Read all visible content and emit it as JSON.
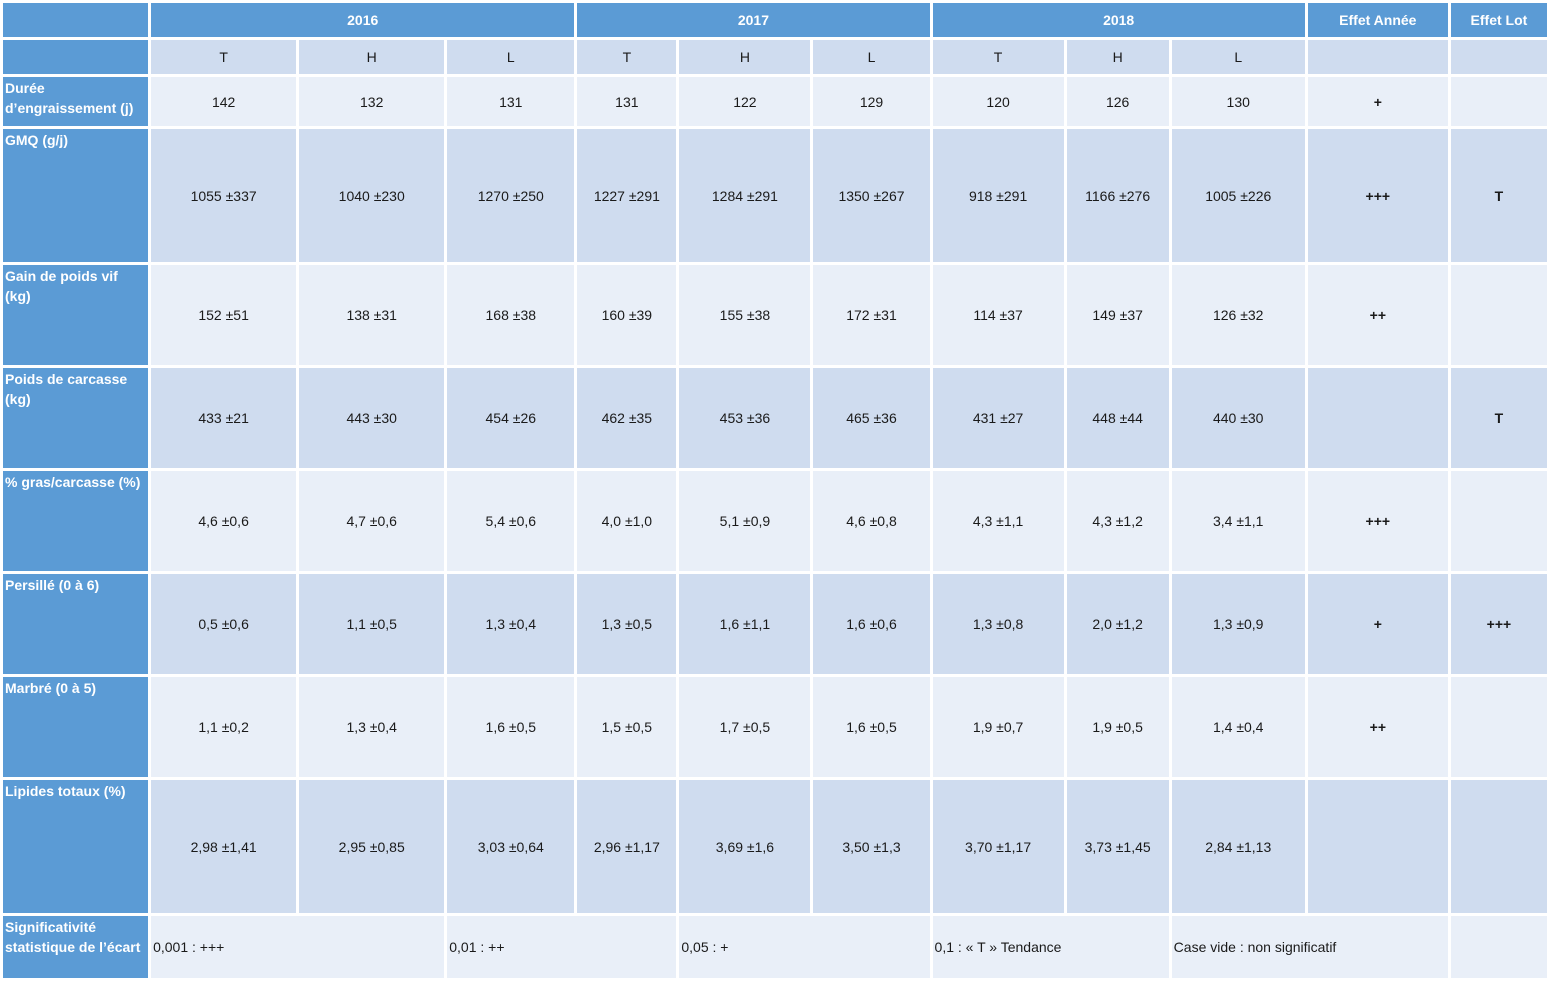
{
  "header": {
    "years": [
      "2016",
      "2017",
      "2018"
    ],
    "effet_annee": "Effet Année",
    "effet_lot": "Effet Lot",
    "subcols": [
      "T",
      "H",
      "L",
      "T",
      "H",
      "L",
      "T",
      "H",
      "L"
    ]
  },
  "rows": [
    {
      "label": "Durée d’engraissement (j)",
      "values": [
        "142",
        "132",
        "131",
        "131",
        "122",
        "129",
        "120",
        "126",
        "130"
      ],
      "effet_annee": "+",
      "effet_lot": ""
    },
    {
      "label": "GMQ (g/j)",
      "values": [
        "1055 ±337",
        "1040 ±230",
        "1270 ±250",
        "1227 ±291",
        "1284 ±291",
        "1350 ±267",
        "918 ±291",
        "1166 ±276",
        "1005 ±226"
      ],
      "effet_annee": "+++",
      "effet_lot": "T"
    },
    {
      "label": "Gain de poids vif (kg)",
      "values": [
        "152 ±51",
        "138 ±31",
        "168 ±38",
        "160 ±39",
        "155 ±38",
        "172 ±31",
        "114 ±37",
        "149 ±37",
        "126 ±32"
      ],
      "effet_annee": "++",
      "effet_lot": ""
    },
    {
      "label": "Poids de carcasse (kg)",
      "values": [
        "433 ±21",
        "443 ±30",
        "454 ±26",
        "462 ±35",
        "453 ±36",
        "465 ±36",
        "431 ±27",
        "448 ±44",
        "440 ±30"
      ],
      "effet_annee": "",
      "effet_lot": "T"
    },
    {
      "label": "% gras/carcasse (%)",
      "values": [
        "4,6 ±0,6",
        "4,7 ±0,6",
        "5,4 ±0,6",
        "4,0 ±1,0",
        "5,1 ±0,9",
        "4,6 ±0,8",
        "4,3 ±1,1",
        "4,3 ±1,2",
        "3,4 ±1,1"
      ],
      "effet_annee": "+++",
      "effet_lot": ""
    },
    {
      "label": "Persillé (0 à 6)",
      "values": [
        "0,5 ±0,6",
        "1,1 ±0,5",
        "1,3 ±0,4",
        "1,3 ±0,5",
        "1,6 ±1,1",
        "1,6 ±0,6",
        "1,3 ±0,8",
        "2,0 ±1,2",
        "1,3 ±0,9"
      ],
      "effet_annee": "+",
      "effet_lot": "+++"
    },
    {
      "label": "Marbré (0 à 5)",
      "values": [
        "1,1 ±0,2",
        "1,3 ±0,4",
        "1,6 ±0,5",
        "1,5 ±0,5",
        "1,7 ±0,5",
        "1,6 ±0,5",
        "1,9 ±0,7",
        "1,9 ±0,5",
        "1,4 ±0,4"
      ],
      "effet_annee": "++",
      "effet_lot": ""
    },
    {
      "label": "Lipides totaux (%)",
      "values": [
        "2,98 ±1,41",
        "2,95 ±0,85",
        "3,03 ±0,64",
        "2,96 ±1,17",
        "3,69 ±1,6",
        "3,50 ±1,3",
        "3,70 ±1,17",
        "3,73 ±1,45",
        "2,84 ±1,13"
      ],
      "effet_annee": "",
      "effet_lot": ""
    }
  ],
  "legend": {
    "label": "Significativité statistique de l’écart",
    "items": [
      "0,001 : +++",
      "0,01 : ++",
      "0,05 : +",
      "0,1 : « T » Tendance",
      "Case vide : non significatif"
    ]
  },
  "colors": {
    "header_blue": "#5b9bd5",
    "cell_dark": "#cfdcef",
    "cell_light": "#e9eff8"
  }
}
